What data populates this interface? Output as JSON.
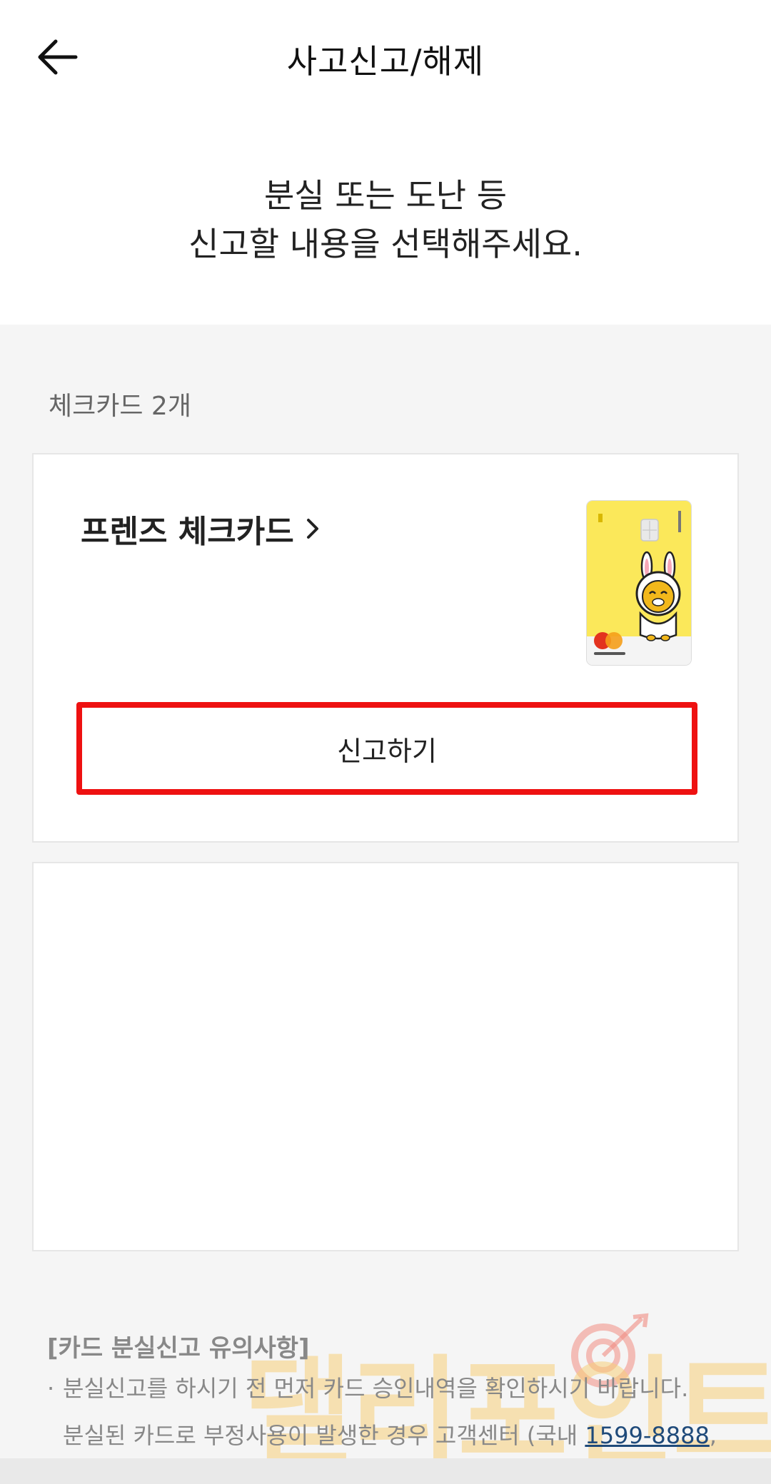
{
  "header": {
    "title": "사고신고/해제",
    "back_icon": "arrow-left-icon"
  },
  "headline": {
    "line1": "분실 또는 도난 등",
    "line2": "신고할 내용을 선택해주세요."
  },
  "section": {
    "label": "체크카드 2개"
  },
  "cards": [
    {
      "name": "프렌즈 체크카드",
      "chevron_icon": "chevron-right-icon",
      "report_label": "신고하기",
      "card_color": "#fbe85a",
      "card_brand": "mastercard"
    }
  ],
  "notice": {
    "title": "[카드 분실신고 유의사항]",
    "line1": "분실신고를 하시기 전 먼저 카드 승인내역을 확인하시기 바랍니다.",
    "line2_prefix": "분실된 카드로 부정사용이 발생한 경우 고객센터 (국내 ",
    "phone": "1599-8888",
    "line2_suffix": ","
  },
  "watermark": {
    "text": "댈리포인트"
  },
  "colors": {
    "highlight": "#ee1111",
    "link": "#1f4a7a",
    "card_yellow": "#fbe85a"
  }
}
